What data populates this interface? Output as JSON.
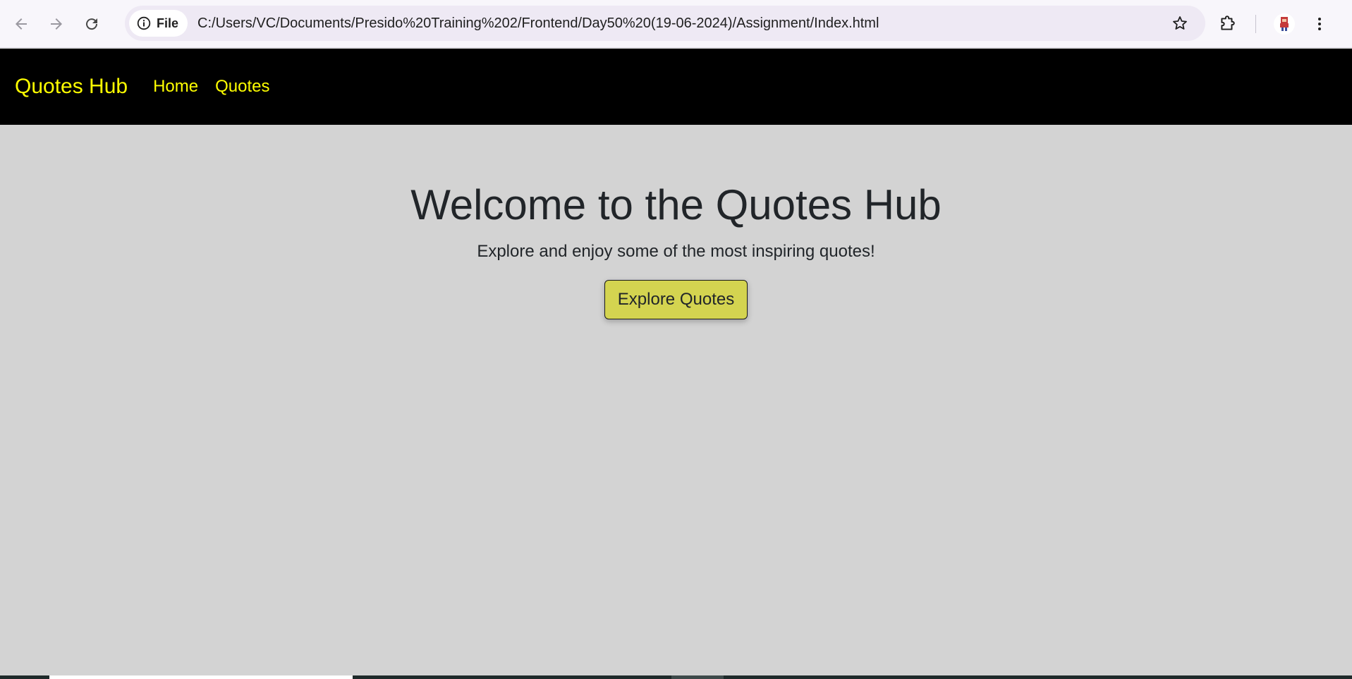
{
  "browser": {
    "site_chip_label": "File",
    "url": "C:/Users/VC/Documents/Presido%20Training%202/Frontend/Day50%20(19-06-2024)/Assignment/Index.html",
    "icons": [
      "back-arrow-icon",
      "forward-arrow-icon",
      "reload-icon",
      "info-icon",
      "star-icon",
      "extensions-icon",
      "profile-avatar",
      "kebab-menu-icon"
    ]
  },
  "navbar": {
    "brand": "Quotes Hub",
    "links": [
      {
        "label": "Home"
      },
      {
        "label": "Quotes"
      }
    ]
  },
  "hero": {
    "title": "Welcome to the Quotes Hub",
    "subtitle": "Explore and enjoy some of the most inspiring quotes!",
    "button_label": "Explore Quotes"
  },
  "colors": {
    "navbar_bg": "#000000",
    "navbar_text": "#ffff00",
    "page_bg": "#d3d3d3",
    "button_bg": "#d4d450"
  }
}
